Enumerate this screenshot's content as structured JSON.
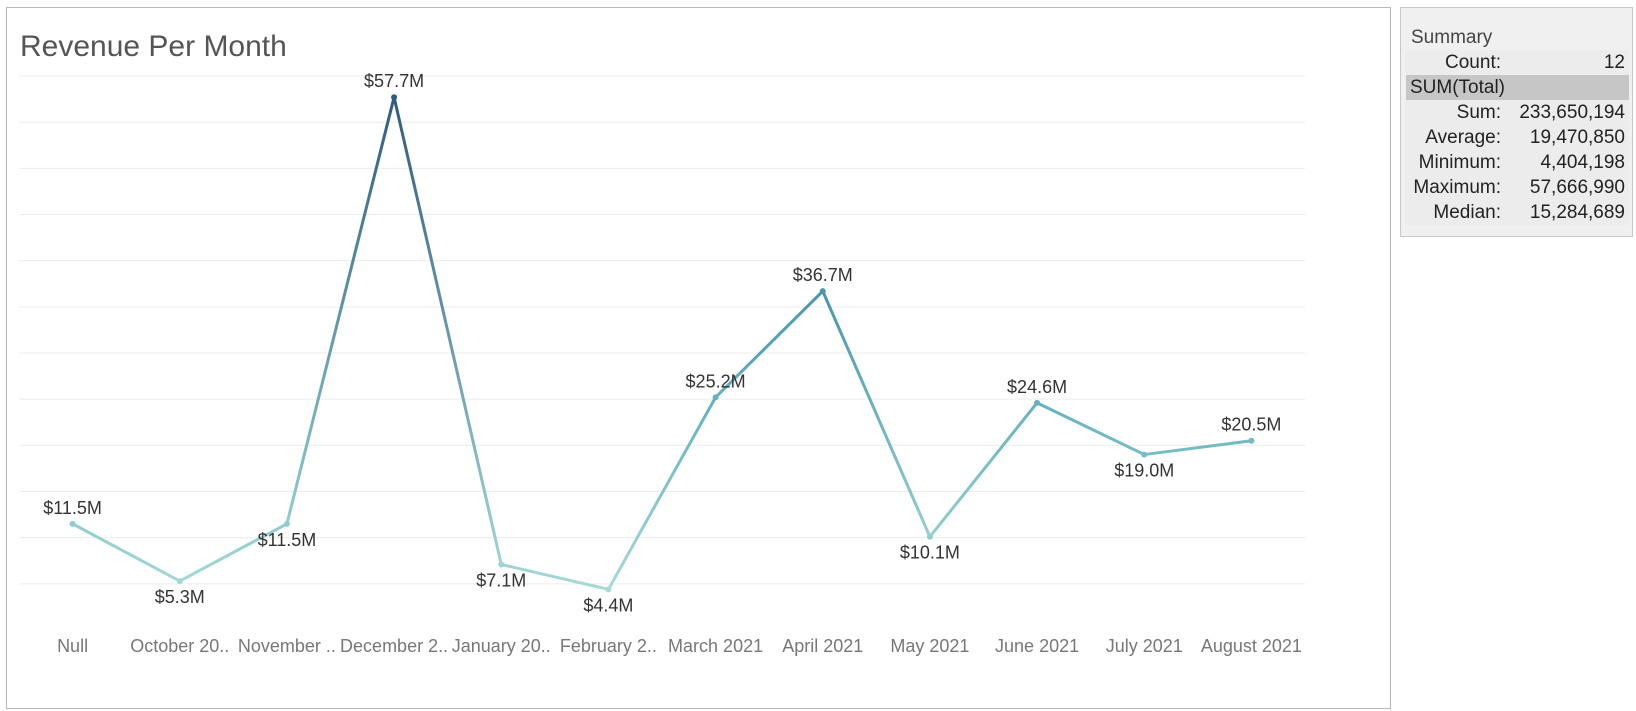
{
  "chart_data": {
    "type": "line",
    "title": "Revenue Per Month",
    "categories": [
      "Null",
      "October 20..",
      "November ..",
      "December 2..",
      "January 20..",
      "February 2..",
      "March 2021",
      "April 2021",
      "May 2021",
      "June 2021",
      "July 2021",
      "August 2021"
    ],
    "values": [
      11.5,
      5.3,
      11.5,
      57.7,
      7.1,
      4.4,
      25.2,
      36.7,
      10.1,
      24.6,
      19.0,
      20.5
    ],
    "labels": [
      "$11.5M",
      "$5.3M",
      "$11.5M",
      "$57.7M",
      "$7.1M",
      "$4.4M",
      "$25.2M",
      "$36.7M",
      "$10.1M",
      "$24.6M",
      "$19.0M",
      "$20.5M"
    ],
    "label_placement": [
      "above",
      "below",
      "below",
      "above",
      "below",
      "below",
      "above",
      "above",
      "below",
      "above",
      "below",
      "above"
    ],
    "ylim": [
      0,
      60
    ],
    "grid": true,
    "color_low": "#a8dad6",
    "color_mid": "#4fa6b8",
    "color_high": "#2f5b80"
  },
  "summary": {
    "title": "Summary",
    "count_label": "Count:",
    "count_value": "12",
    "measure_header": "SUM(Total)",
    "rows": [
      {
        "label": "Sum:",
        "value": "233,650,194"
      },
      {
        "label": "Average:",
        "value": "19,470,850"
      },
      {
        "label": "Minimum:",
        "value": "4,404,198"
      },
      {
        "label": "Maximum:",
        "value": "57,666,990"
      },
      {
        "label": "Median:",
        "value": "15,284,689"
      }
    ]
  }
}
